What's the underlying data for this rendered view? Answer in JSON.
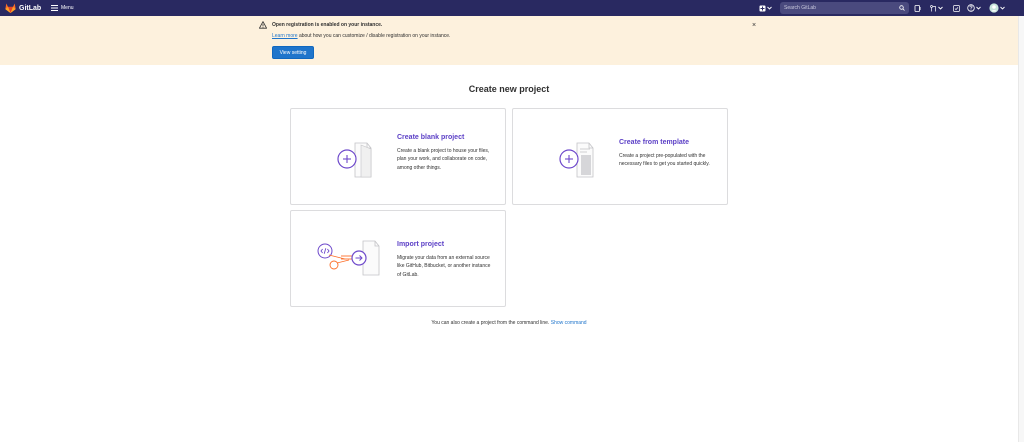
{
  "navbar": {
    "brand": "GitLab",
    "menu_label": "Menu",
    "search_placeholder": "Search GitLab"
  },
  "banner": {
    "title": "Open registration is enabled on your instance.",
    "learn_more": "Learn more",
    "text": " about how you can customize / disable registration on your instance.",
    "button_label": "View setting",
    "close_symbol": "×"
  },
  "page": {
    "title": "Create new project"
  },
  "cards": [
    {
      "title": "Create blank project",
      "description": "Create a blank project to house your files, plan your work, and collaborate on code, among other things."
    },
    {
      "title": "Create from template",
      "description": "Create a project pre-populated with the necessary files to get you started quickly."
    },
    {
      "title": "Import project",
      "description": "Migrate your data from an external source like GitHub, Bitbucket, or another instance of GitLab."
    }
  ],
  "footer": {
    "text": "You can also create a project from the command line. ",
    "link": "Show command"
  },
  "colors": {
    "navbar": "#292961",
    "banner": "#fdf1dd",
    "primary_button": "#1f75cb",
    "card_title": "#5b3fc6"
  }
}
